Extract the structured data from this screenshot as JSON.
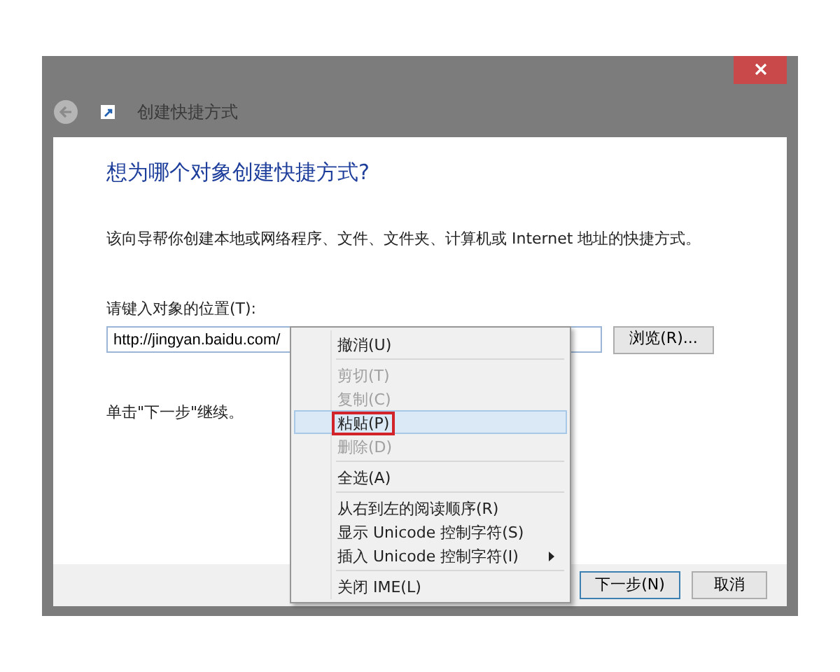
{
  "window": {
    "title": "创建快捷方式"
  },
  "heading": "想为哪个对象创建快捷方式?",
  "description": "该向导帮你创建本地或网络程序、文件、文件夹、计算机或 Internet 地址的快捷方式。",
  "location": {
    "label": "请键入对象的位置(T):",
    "value": "http://jingyan.baidu.com/",
    "browse_button": "浏览(R)..."
  },
  "hint": "单击\"下一步\"继续。",
  "buttons": [
    {
      "label": "下一步(N)",
      "default": true
    },
    {
      "label": "取消",
      "default": false
    }
  ],
  "context_menu": [
    {
      "kind": "item",
      "label": "撤消(U)",
      "disabled": false,
      "selected": false,
      "annotated": false,
      "submenu": false
    },
    {
      "kind": "separator"
    },
    {
      "kind": "item",
      "label": "剪切(T)",
      "disabled": true,
      "selected": false,
      "annotated": false,
      "submenu": false
    },
    {
      "kind": "item",
      "label": "复制(C)",
      "disabled": true,
      "selected": false,
      "annotated": false,
      "submenu": false
    },
    {
      "kind": "item",
      "label": "粘贴(P)",
      "disabled": false,
      "selected": true,
      "annotated": true,
      "submenu": false
    },
    {
      "kind": "item",
      "label": "删除(D)",
      "disabled": true,
      "selected": false,
      "annotated": false,
      "submenu": false
    },
    {
      "kind": "separator"
    },
    {
      "kind": "item",
      "label": "全选(A)",
      "disabled": false,
      "selected": false,
      "annotated": false,
      "submenu": false
    },
    {
      "kind": "separator"
    },
    {
      "kind": "item",
      "label": "从右到左的阅读顺序(R)",
      "disabled": false,
      "selected": false,
      "annotated": false,
      "submenu": false
    },
    {
      "kind": "item",
      "label": "显示 Unicode 控制字符(S)",
      "disabled": false,
      "selected": false,
      "annotated": false,
      "submenu": false
    },
    {
      "kind": "item",
      "label": "插入 Unicode 控制字符(I)",
      "disabled": false,
      "selected": false,
      "annotated": false,
      "submenu": true
    },
    {
      "kind": "separator"
    },
    {
      "kind": "item",
      "label": "关闭 IME(L)",
      "disabled": false,
      "selected": false,
      "annotated": false,
      "submenu": false
    }
  ]
}
